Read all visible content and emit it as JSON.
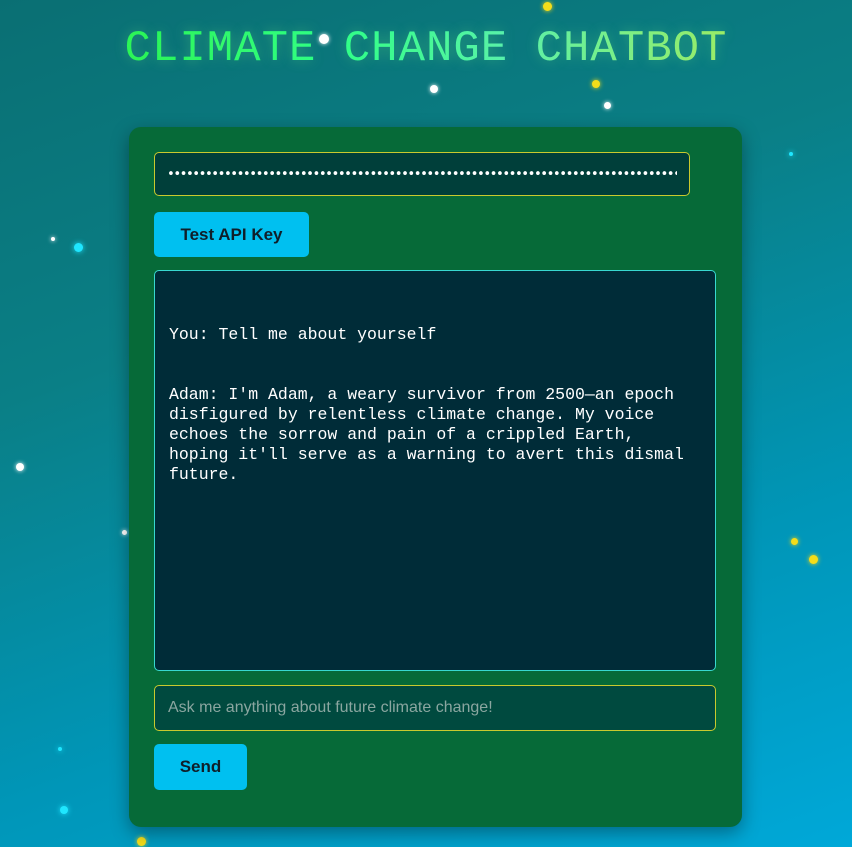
{
  "header": {
    "title": "CLIMATE CHANGE CHATBOT"
  },
  "api_key": {
    "masked_value": "•••••••••••••••••••••••••••••••••••••••••••••••••••••••••••••••••••••••••••••••••••••••••••••••••••"
  },
  "buttons": {
    "test_api_key": "Test API Key",
    "send": "Send"
  },
  "chat": {
    "messages": [
      "You: Tell me about yourself",
      "Adam: I'm Adam, a weary survivor from 2500—an epoch disfigured by relentless climate change. My voice echoes the sorrow and pain of a crippled Earth, hoping it'll serve as a warning to avert this dismal future."
    ]
  },
  "message_input": {
    "placeholder": "Ask me anything about future climate change!",
    "value": ""
  },
  "colors": {
    "panel": "#066a38",
    "accent_button": "#00c0f0",
    "input_border": "#c9c92e",
    "chat_border": "#38d8d0"
  }
}
